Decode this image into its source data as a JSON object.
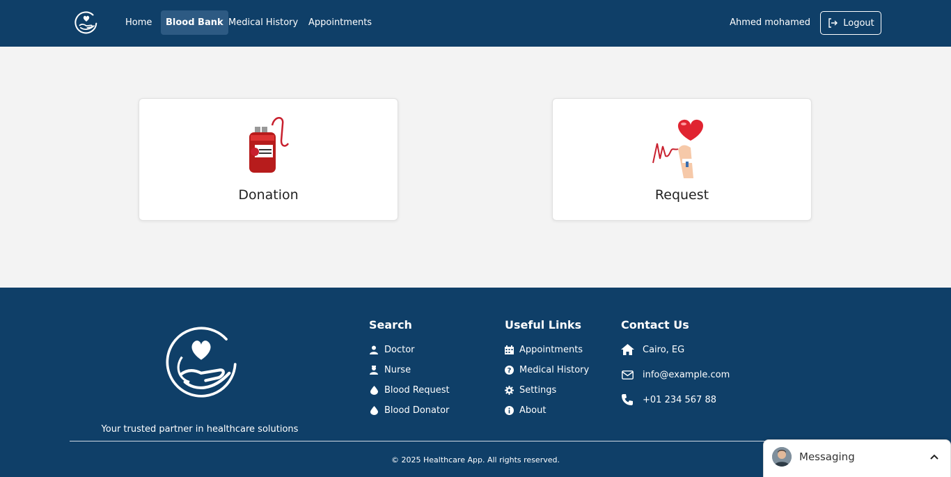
{
  "nav": {
    "links": [
      {
        "label": "Home"
      },
      {
        "label": "Blood Bank"
      },
      {
        "label": "Medical History"
      },
      {
        "label": "Appointments"
      }
    ],
    "user_name": "Ahmed mohamed",
    "logout_label": "Logout"
  },
  "cards": {
    "donation_label": "Donation",
    "request_label": "Request"
  },
  "footer": {
    "tagline": "Your trusted partner in healthcare solutions",
    "search": {
      "title": "Search",
      "items": [
        {
          "label": "Doctor",
          "icon": "doctor-icon"
        },
        {
          "label": "Nurse",
          "icon": "nurse-icon"
        },
        {
          "label": "Blood Request",
          "icon": "blood-drop-icon"
        },
        {
          "label": "Blood Donator",
          "icon": "blood-drop-icon"
        }
      ]
    },
    "useful_links": {
      "title": "Useful Links",
      "items": [
        {
          "label": "Appointments",
          "icon": "calendar-icon"
        },
        {
          "label": "Medical History",
          "icon": "question-circle-icon"
        },
        {
          "label": "Settings",
          "icon": "gear-icon"
        },
        {
          "label": "About",
          "icon": "info-circle-icon"
        }
      ]
    },
    "contact": {
      "title": "Contact Us",
      "items": [
        {
          "label": "Cairo, EG",
          "icon": "home-icon"
        },
        {
          "label": "info@example.com",
          "icon": "envelope-icon"
        },
        {
          "label": "+01 234 567 88",
          "icon": "phone-icon"
        }
      ]
    },
    "copyright": "© 2025 Healthcare App. All rights reserved."
  },
  "messaging": {
    "label": "Messaging"
  },
  "colors": {
    "primary": "#0f3f68",
    "nav_active": "#2d5a83",
    "background": "#f3f3f3",
    "blood_red": "#c8202e"
  }
}
